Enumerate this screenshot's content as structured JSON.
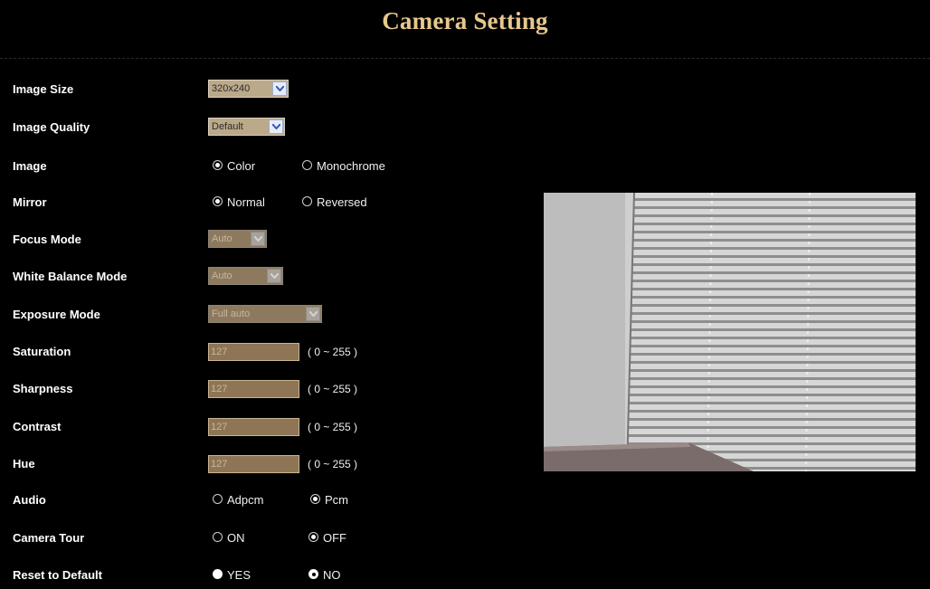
{
  "page": {
    "title": "Camera Setting"
  },
  "image_size": {
    "label": "Image Size",
    "value": "320x240"
  },
  "image_quality": {
    "label": "Image Quality",
    "value": "Default"
  },
  "image": {
    "label": "Image",
    "options": [
      "Color",
      "Monochrome"
    ],
    "selected": "Color"
  },
  "mirror": {
    "label": "Mirror",
    "options": [
      "Normal",
      "Reversed"
    ],
    "selected": "Normal"
  },
  "focus_mode": {
    "label": "Focus Mode",
    "value": "Auto"
  },
  "white_balance_mode": {
    "label": "White Balance Mode",
    "value": "Auto"
  },
  "exposure_mode": {
    "label": "Exposure Mode",
    "value": "Full auto"
  },
  "saturation": {
    "label": "Saturation",
    "value": "127",
    "range": "( 0 ~ 255 )"
  },
  "sharpness": {
    "label": "Sharpness",
    "value": "127",
    "range": "( 0 ~ 255 )"
  },
  "contrast": {
    "label": "Contrast",
    "value": "127",
    "range": "( 0 ~ 255 )"
  },
  "hue": {
    "label": "Hue",
    "value": "127",
    "range": "( 0 ~ 255 )"
  },
  "audio": {
    "label": "Audio",
    "options": [
      "Adpcm",
      "Pcm"
    ],
    "selected": "Pcm"
  },
  "camera_tour": {
    "label": "Camera Tour",
    "options": [
      "ON",
      "OFF"
    ],
    "selected": "OFF"
  },
  "reset": {
    "label": "Reset to Default",
    "options": [
      "YES",
      "NO"
    ],
    "selected": "NO"
  },
  "colors": {
    "title": "#e8c88e",
    "field": "#bca98a",
    "field_disabled": "#8d7a5e",
    "background": "#000000"
  },
  "icons": {
    "dropdown": "chevron-down-icon",
    "preview": "camera-preview"
  }
}
